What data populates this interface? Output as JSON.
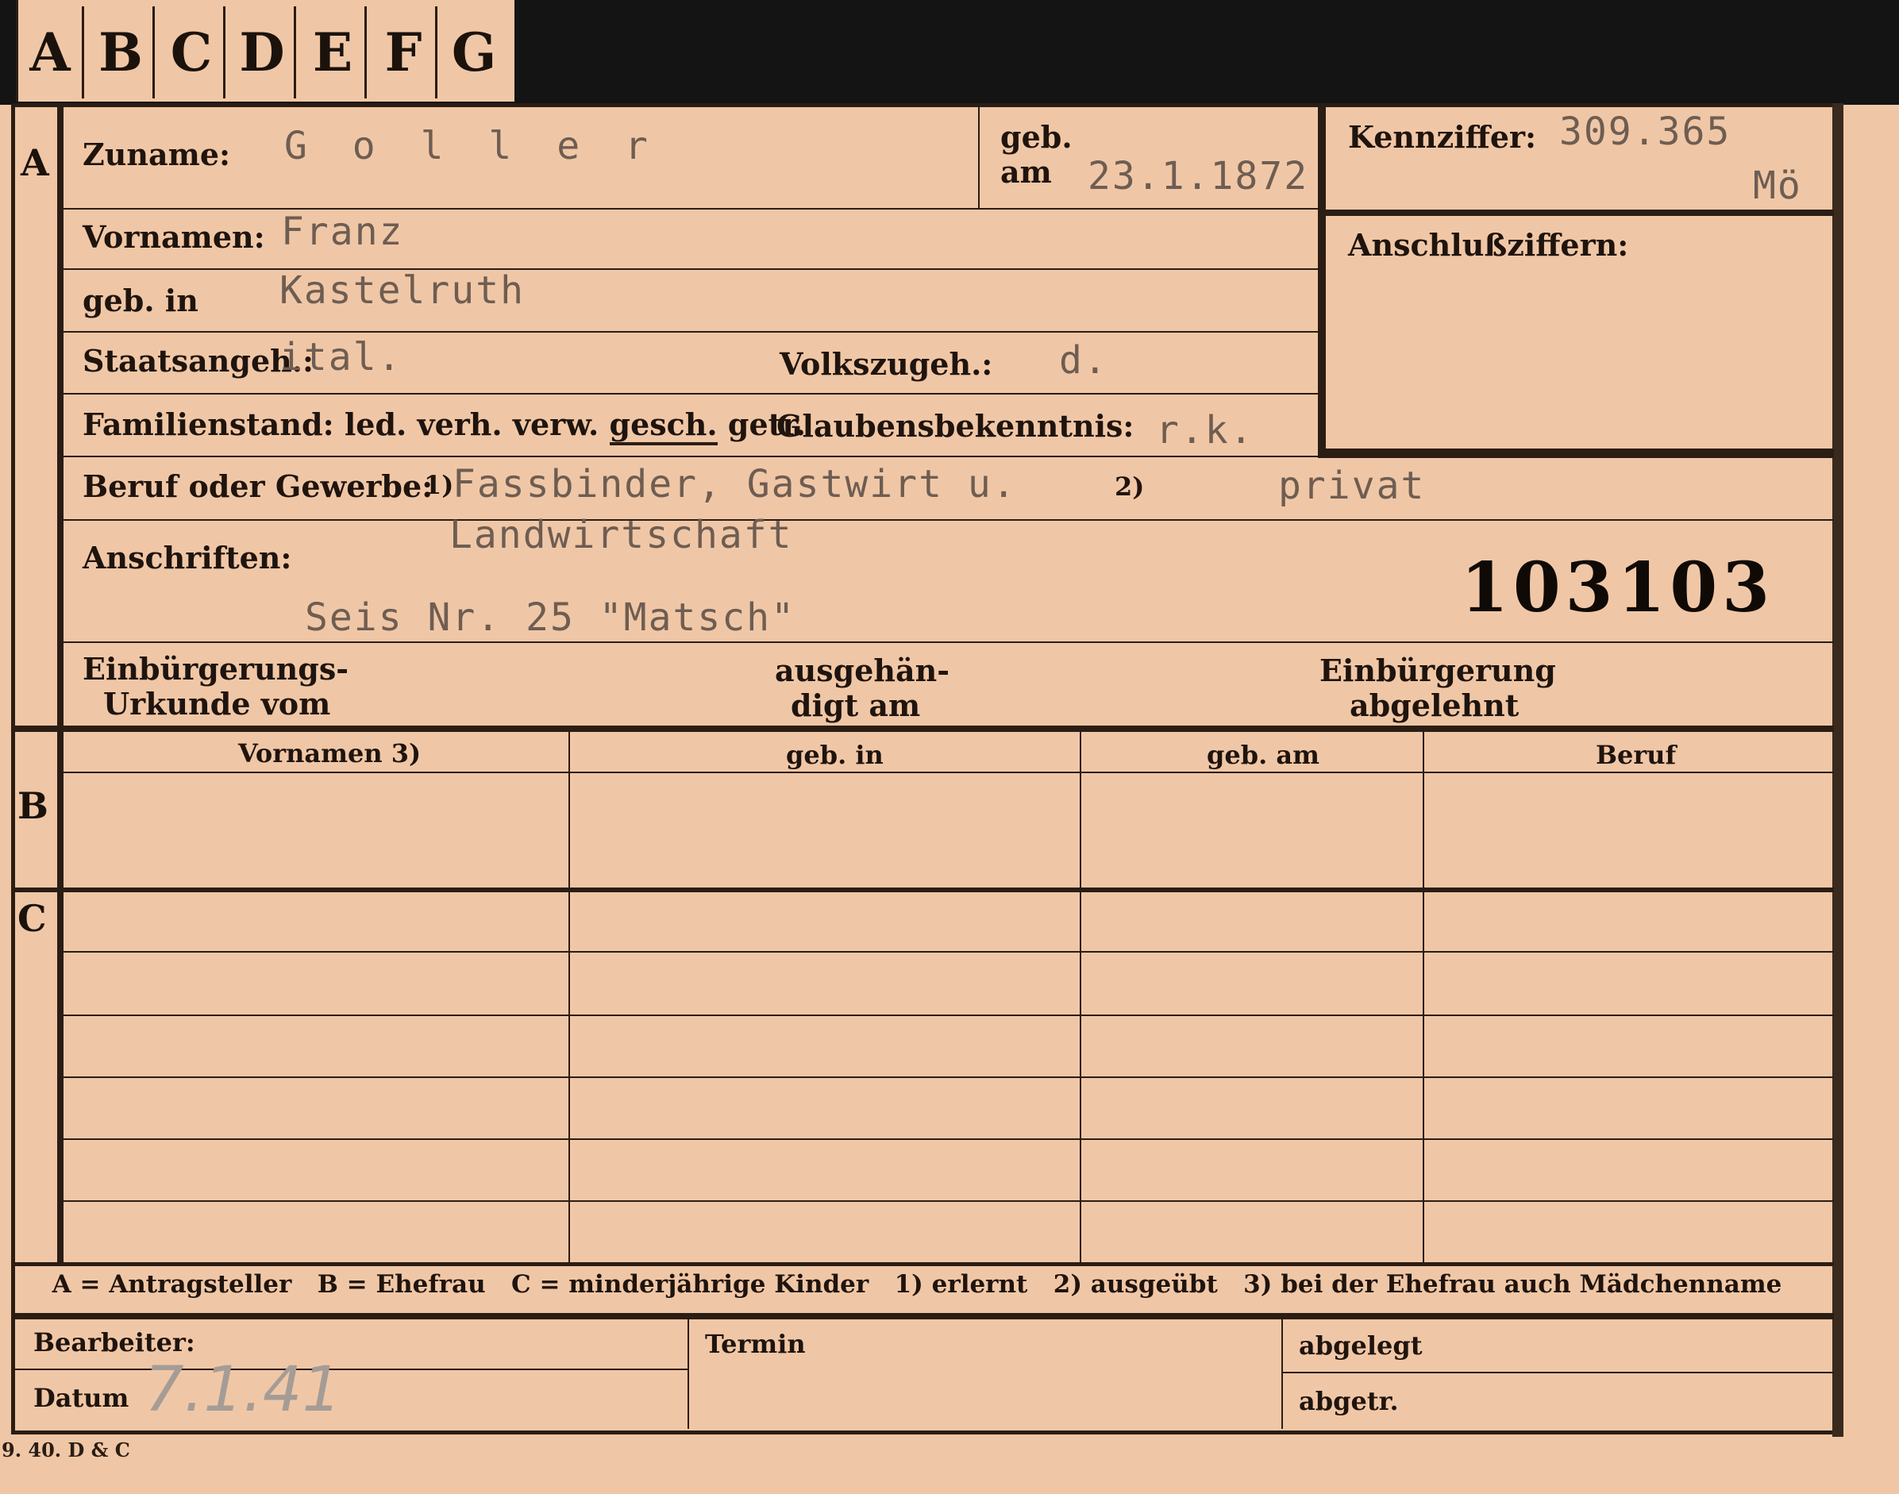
{
  "tabs": [
    "A",
    "B",
    "C",
    "D",
    "E",
    "F",
    "G"
  ],
  "sections": {
    "a": "A",
    "b": "B",
    "c": "C"
  },
  "labels": {
    "zuname": "Zuname:",
    "geb": "geb.",
    "am": "am",
    "kennziffer": "Kennziffer:",
    "anschlussziffern": "Anschlußziffern:",
    "vornamen": "Vornamen:",
    "geb_in": "geb. in",
    "staatsangeh": "Staatsangeh.:",
    "volkszugeh": "Volkszugeh.:",
    "familienstand_prefix": "Familienstand: led. verh. verw.",
    "familienstand_gesch": "gesch.",
    "familienstand_suffix": "getr.",
    "glaubensbekenntnis": "Glaubensbekenntnis:",
    "beruf": "Beruf oder Gewerbe:",
    "note1": "1)",
    "note2": "2)",
    "anschriften": "Anschriften:",
    "einbuergerung_1": "Einbürgerungs-",
    "einbuergerung_2": "Urkunde vom",
    "ausgehaen_1": "ausgehän-",
    "ausgehaen_2": "digt am",
    "abgelehnt_1": "Einbürgerung",
    "abgelehnt_2": "abgelehnt",
    "legend": "A = Antragsteller   B = Ehefrau   C = minderjährige Kinder   1) erlernt   2) ausgeübt   3) bei der Ehefrau auch Mädchenname",
    "bearbeiter": "Bearbeiter:",
    "datum": "Datum",
    "termin": "Termin",
    "abgelegt": "abgelegt",
    "abgetr": "abgetr.",
    "print_mark": "9. 40. D & C"
  },
  "columns": [
    "Vornamen 3)",
    "geb. in",
    "geb. am",
    "Beruf"
  ],
  "values": {
    "zuname": "G o l l e r",
    "geb_am": "23.1.1872",
    "kennziffer": "309.365",
    "kennziffer_suffix": "Mö",
    "vornamen": "Franz",
    "geb_in": "Kastelruth",
    "staatsangeh": "ital.",
    "volkszugeh": "d.",
    "glaubensbekenntnis": "r.k.",
    "beruf_erlernt": "Fassbinder, Gastwirt u.",
    "beruf_erlernt_2": "Landwirtschaft",
    "beruf_ausgeuebt": "privat",
    "anschrift": "Seis Nr. 25 \"Matsch\"",
    "stamp_number": "103103",
    "datum": "7.1.41"
  }
}
